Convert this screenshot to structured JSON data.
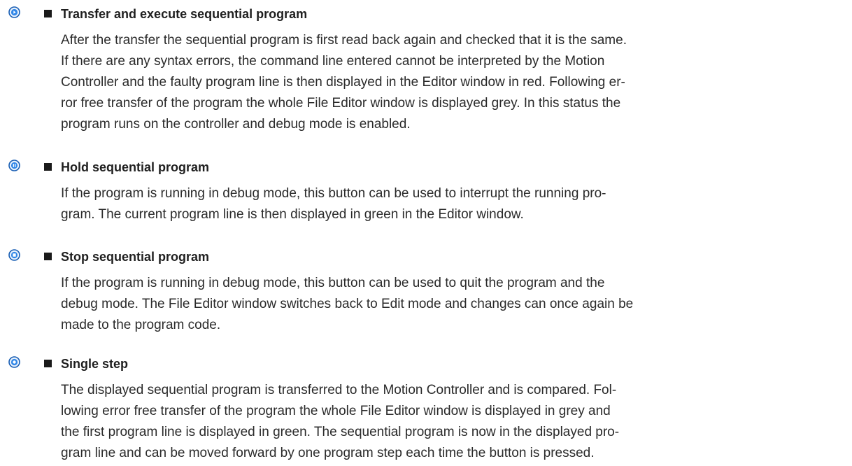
{
  "colors": {
    "icon_ring": "#1a5fb4",
    "icon_inner": "#2f86e8",
    "text": "#2a2a2a",
    "bullet": "#1a1a1a"
  },
  "sections": [
    {
      "icon": "play-circle-icon",
      "heading": "Transfer and execute sequential program",
      "lines": [
        "After the transfer the sequential program is first read back again and checked that it is the same.",
        "If there are any syntax errors, the command line entered cannot be interpreted by the Motion",
        "Controller and the faulty program line is then displayed in the Editor window in red. Following er-",
        "ror free transfer of the program the whole File Editor window is displayed grey. In this status the",
        "program runs on the controller and debug mode is enabled."
      ]
    },
    {
      "icon": "pause-circle-icon",
      "heading": "Hold sequential program",
      "lines": [
        "If the program is running in debug mode, this button can be used to interrupt the running pro-",
        "gram. The current program line is then displayed in green in the Editor window."
      ]
    },
    {
      "icon": "stop-circle-icon",
      "heading": "Stop sequential program",
      "lines": [
        "If the program is running in debug mode, this button can be used to quit the program and the",
        "debug mode. The File Editor window switches back to Edit mode and changes can once again be",
        "made to the program code."
      ]
    },
    {
      "icon": "step-circle-icon",
      "heading": "Single step",
      "lines": [
        "The displayed sequential program is transferred to the Motion Controller and is compared. Fol-",
        "lowing error free transfer of the program the whole File Editor window is displayed in grey and",
        "the first program line is displayed in green. The sequential program is now in the displayed pro-",
        "gram line and can be moved forward by one program step each time the button is pressed."
      ]
    }
  ]
}
